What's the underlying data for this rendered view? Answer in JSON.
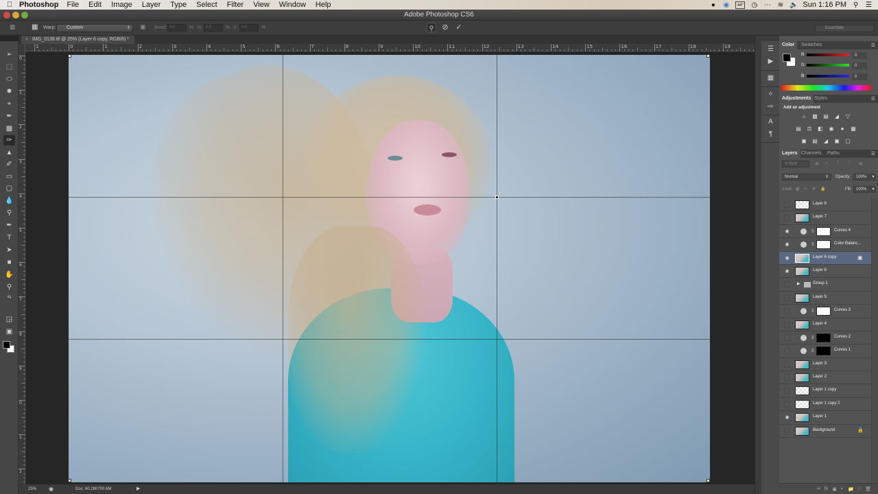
{
  "menubar": {
    "app_name": "Photoshop",
    "items": [
      "File",
      "Edit",
      "Image",
      "Layer",
      "Type",
      "Select",
      "Filter",
      "View",
      "Window",
      "Help"
    ],
    "tray": {
      "temperature": "44°",
      "clock": "Sun 1:16 PM"
    }
  },
  "window": {
    "title": "Adobe Photoshop CS6"
  },
  "options": {
    "warp_label": "Warp:",
    "warp_value": "Custom",
    "bend_label": "Bend:",
    "bend_value": "0.0",
    "h_label": "H:",
    "h_value": "0.0",
    "v_label": "V:",
    "v_value": "0.0",
    "percent": "%",
    "workspace": "Essentials"
  },
  "document": {
    "tab_title": "IMG_0138.tif @ 25% (Layer 6 copy, RGB/8) *",
    "close": "×"
  },
  "rulers": {
    "top": [
      "1",
      "0",
      "1",
      "2",
      "3",
      "4",
      "5",
      "6",
      "7",
      "8",
      "9",
      "10",
      "11",
      "12",
      "13",
      "14",
      "15",
      "16",
      "17",
      "18",
      "19"
    ],
    "left": [
      "0",
      "1",
      "2",
      "3",
      "4",
      "5",
      "6",
      "7",
      "8",
      "9",
      "0",
      "1",
      "2"
    ]
  },
  "status": {
    "zoom": "25%",
    "doc_size": "Doc: 60.2M/700.6M"
  },
  "color_panel": {
    "tabs": [
      "Color",
      "Swatches"
    ],
    "channels": [
      {
        "label": "R",
        "value": "0",
        "color": "#e0262a"
      },
      {
        "label": "G",
        "value": "0",
        "color": "#2ee02a"
      },
      {
        "label": "B",
        "value": "0",
        "color": "#2a2ae0"
      }
    ],
    "foreground": "#000000",
    "background": "#ffffff"
  },
  "adjustments_panel": {
    "tabs": [
      "Adjustments",
      "Styles"
    ],
    "title": "Add an adjustment",
    "icons_row1": [
      "brightness-contrast",
      "levels",
      "curves",
      "exposure",
      "vibrance"
    ],
    "icons_row2": [
      "hue-saturation",
      "color-balance",
      "black-white",
      "photo-filter",
      "channel-mixer",
      "color-lookup"
    ],
    "icons_row3": [
      "invert",
      "posterize",
      "threshold",
      "selective-color",
      "gradient-map"
    ]
  },
  "layers_panel": {
    "tabs": [
      "Layers",
      "Channels",
      "Paths"
    ],
    "filter_kind": "Kind",
    "blend_mode": "Normal",
    "opacity_label": "Opacity:",
    "opacity_value": "100%",
    "lock_label": "Lock:",
    "fill_label": "Fill:",
    "fill_value": "100%",
    "layers": [
      {
        "name": "Layer 8",
        "visible": false,
        "type": "pixel",
        "thumb": "trans"
      },
      {
        "name": "Layer 7",
        "visible": false,
        "type": "pixel",
        "thumb": "photo"
      },
      {
        "name": "Curves 4",
        "visible": true,
        "type": "adjustment",
        "mask": "white"
      },
      {
        "name": "Color Balanc...",
        "visible": true,
        "type": "adjustment",
        "mask": "white"
      },
      {
        "name": "Layer 6 copy",
        "visible": true,
        "type": "smart",
        "thumb": "photo",
        "selected": true
      },
      {
        "name": "Layer 6",
        "visible": true,
        "type": "pixel",
        "thumb": "photo"
      },
      {
        "name": "Group 1",
        "visible": false,
        "type": "group"
      },
      {
        "name": "Layer 5",
        "visible": false,
        "type": "pixel",
        "thumb": "photo"
      },
      {
        "name": "Curves 3",
        "visible": false,
        "type": "adjustment",
        "mask": "white"
      },
      {
        "name": "Layer 4",
        "visible": false,
        "type": "pixel",
        "thumb": "photo"
      },
      {
        "name": "Curves 2",
        "visible": false,
        "type": "adjustment",
        "mask": "black"
      },
      {
        "name": "Curves 1",
        "visible": false,
        "type": "adjustment",
        "mask": "black"
      },
      {
        "name": "Layer 3",
        "visible": false,
        "type": "pixel",
        "thumb": "photo"
      },
      {
        "name": "Layer 2",
        "visible": false,
        "type": "pixel",
        "thumb": "photo"
      },
      {
        "name": "Layer 1 copy",
        "visible": false,
        "type": "pixel",
        "thumb": "trans"
      },
      {
        "name": "Layer 1 copy 2",
        "visible": false,
        "type": "pixel",
        "thumb": "trans"
      },
      {
        "name": "Layer 1",
        "visible": true,
        "type": "pixel",
        "thumb": "photo"
      },
      {
        "name": "Background",
        "visible": false,
        "type": "background",
        "thumb": "photo",
        "locked": true
      }
    ]
  }
}
